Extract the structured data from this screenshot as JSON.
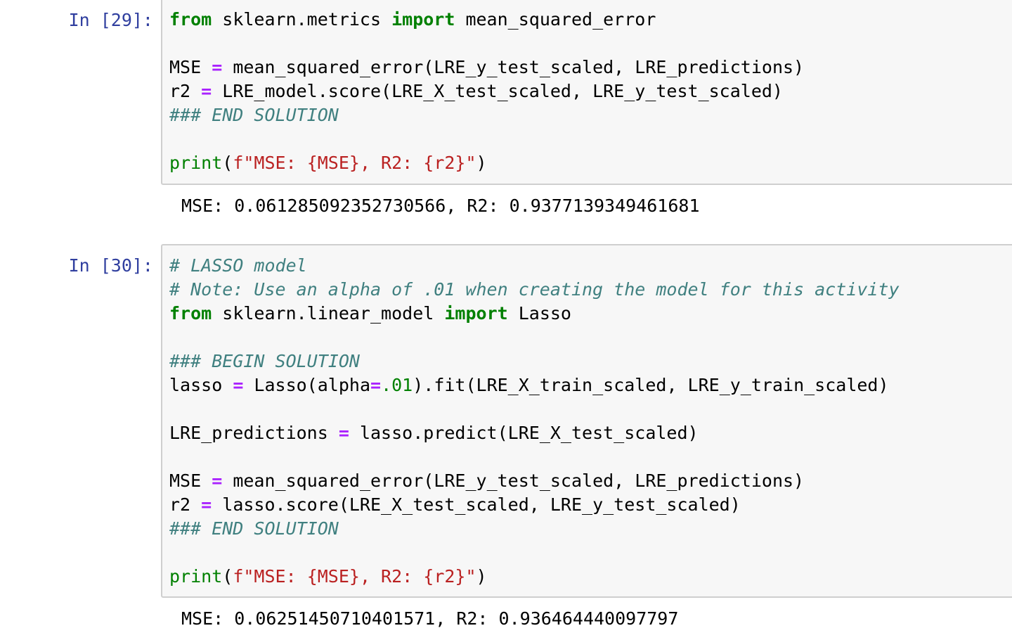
{
  "cells": [
    {
      "prompt": "In [29]:",
      "lines": [
        [
          [
            "kw",
            "from"
          ],
          [
            "plain",
            " sklearn.metrics "
          ],
          [
            "kw",
            "import"
          ],
          [
            "plain",
            " mean_squared_error"
          ]
        ],
        [],
        [
          [
            "plain",
            "MSE "
          ],
          [
            "op",
            "="
          ],
          [
            "plain",
            " mean_squared_error(LRE_y_test_scaled, LRE_predictions)"
          ]
        ],
        [
          [
            "plain",
            "r2 "
          ],
          [
            "op",
            "="
          ],
          [
            "plain",
            " LRE_model.score(LRE_X_test_scaled, LRE_y_test_scaled)"
          ]
        ],
        [
          [
            "cm",
            "### END SOLUTION"
          ]
        ],
        [],
        [
          [
            "bi",
            "print"
          ],
          [
            "plain",
            "("
          ],
          [
            "str",
            "f\"MSE: "
          ],
          [
            "str",
            "{MSE}"
          ],
          [
            "str",
            ", R2: "
          ],
          [
            "str",
            "{r2}"
          ],
          [
            "str",
            "\""
          ],
          [
            "plain",
            ")"
          ]
        ]
      ],
      "output": "MSE: 0.061285092352730566, R2: 0.9377139349461681"
    },
    {
      "prompt": "In [30]:",
      "lines": [
        [
          [
            "cm",
            "# LASSO model"
          ]
        ],
        [
          [
            "cm",
            "# Note: Use an alpha of .01 when creating the model for this activity"
          ]
        ],
        [
          [
            "kw",
            "from"
          ],
          [
            "plain",
            " sklearn.linear_model "
          ],
          [
            "kw",
            "import"
          ],
          [
            "plain",
            " Lasso"
          ]
        ],
        [],
        [
          [
            "cm",
            "### BEGIN SOLUTION"
          ]
        ],
        [
          [
            "plain",
            "lasso "
          ],
          [
            "op",
            "="
          ],
          [
            "plain",
            " Lasso(alpha"
          ],
          [
            "op",
            "="
          ],
          [
            "num",
            ".01"
          ],
          [
            "plain",
            ").fit(LRE_X_train_scaled, LRE_y_train_scaled)"
          ]
        ],
        [],
        [
          [
            "plain",
            "LRE_predictions "
          ],
          [
            "op",
            "="
          ],
          [
            "plain",
            " lasso.predict(LRE_X_test_scaled)"
          ]
        ],
        [],
        [
          [
            "plain",
            "MSE "
          ],
          [
            "op",
            "="
          ],
          [
            "plain",
            " mean_squared_error(LRE_y_test_scaled, LRE_predictions)"
          ]
        ],
        [
          [
            "plain",
            "r2 "
          ],
          [
            "op",
            "="
          ],
          [
            "plain",
            " lasso.score(LRE_X_test_scaled, LRE_y_test_scaled)"
          ]
        ],
        [
          [
            "cm",
            "### END SOLUTION"
          ]
        ],
        [],
        [
          [
            "bi",
            "print"
          ],
          [
            "plain",
            "("
          ],
          [
            "str",
            "f\"MSE: "
          ],
          [
            "str",
            "{MSE}"
          ],
          [
            "str",
            ", R2: "
          ],
          [
            "str",
            "{r2}"
          ],
          [
            "str",
            "\""
          ],
          [
            "plain",
            ")"
          ]
        ]
      ],
      "output": "MSE: 0.06251450710401571, R2: 0.936464440097797"
    }
  ]
}
